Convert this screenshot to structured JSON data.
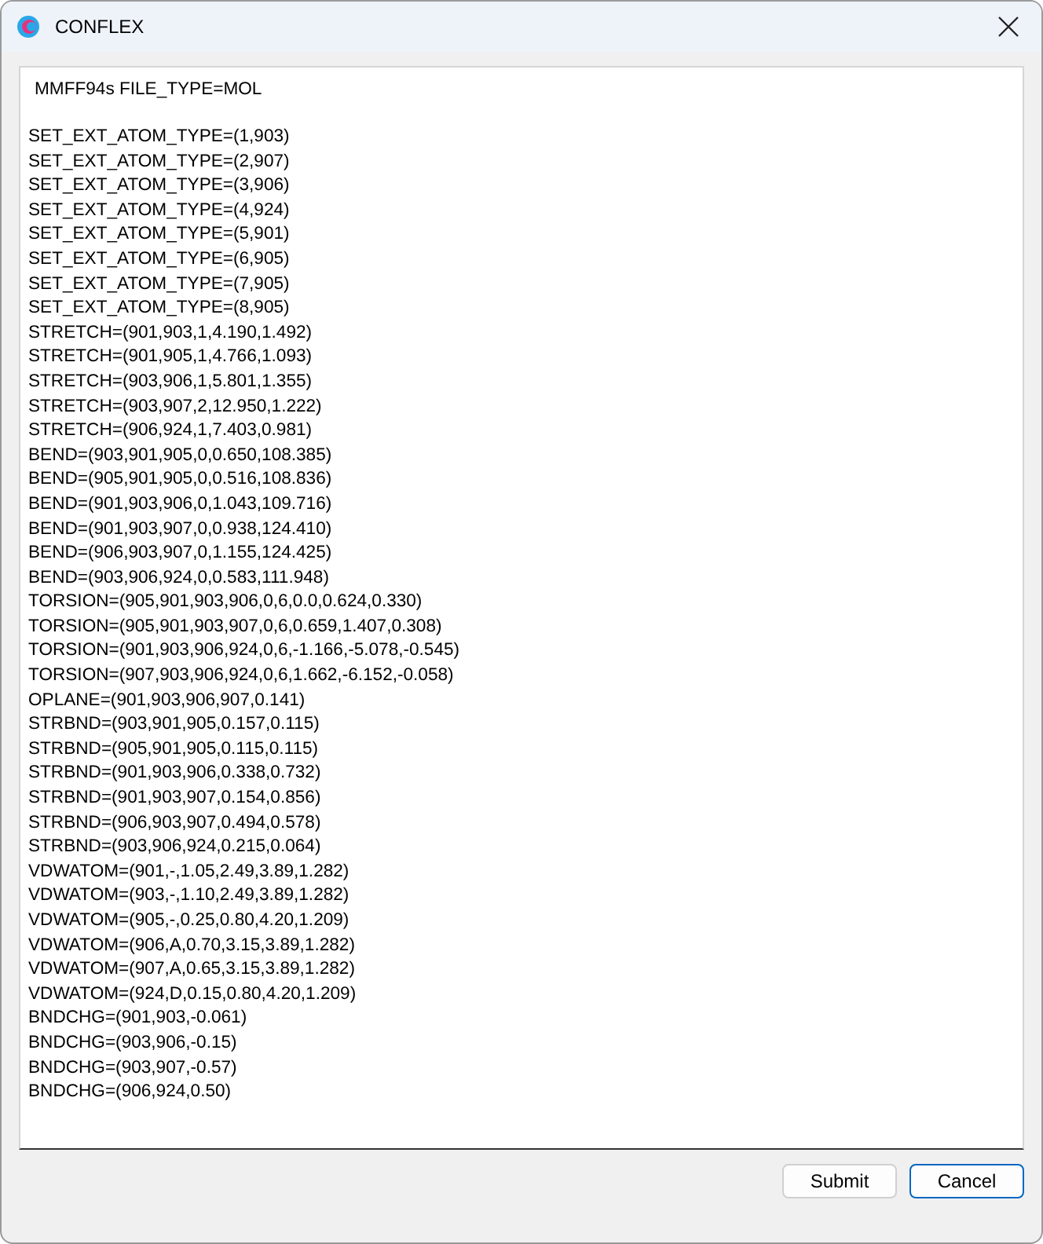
{
  "window": {
    "title": "CONFLEX"
  },
  "editor": {
    "header": "MMFF94s FILE_TYPE=MOL",
    "lines": [
      "SET_EXT_ATOM_TYPE=(1,903)",
      "SET_EXT_ATOM_TYPE=(2,907)",
      "SET_EXT_ATOM_TYPE=(3,906)",
      "SET_EXT_ATOM_TYPE=(4,924)",
      "SET_EXT_ATOM_TYPE=(5,901)",
      "SET_EXT_ATOM_TYPE=(6,905)",
      "SET_EXT_ATOM_TYPE=(7,905)",
      "SET_EXT_ATOM_TYPE=(8,905)",
      "STRETCH=(901,903,1,4.190,1.492)",
      "STRETCH=(901,905,1,4.766,1.093)",
      "STRETCH=(903,906,1,5.801,1.355)",
      "STRETCH=(903,907,2,12.950,1.222)",
      "STRETCH=(906,924,1,7.403,0.981)",
      "BEND=(903,901,905,0,0.650,108.385)",
      "BEND=(905,901,905,0,0.516,108.836)",
      "BEND=(901,903,906,0,1.043,109.716)",
      "BEND=(901,903,907,0,0.938,124.410)",
      "BEND=(906,903,907,0,1.155,124.425)",
      "BEND=(903,906,924,0,0.583,111.948)",
      "TORSION=(905,901,903,906,0,6,0.0,0.624,0.330)",
      "TORSION=(905,901,903,907,0,6,0.659,1.407,0.308)",
      "TORSION=(901,903,906,924,0,6,-1.166,-5.078,-0.545)",
      "TORSION=(907,903,906,924,0,6,1.662,-6.152,-0.058)",
      "OPLANE=(901,903,906,907,0.141)",
      "STRBND=(903,901,905,0.157,0.115)",
      "STRBND=(905,901,905,0.115,0.115)",
      "STRBND=(901,903,906,0.338,0.732)",
      "STRBND=(901,903,907,0.154,0.856)",
      "STRBND=(906,903,907,0.494,0.578)",
      "STRBND=(903,906,924,0.215,0.064)",
      "VDWATOM=(901,-,1.05,2.49,3.89,1.282)",
      "VDWATOM=(903,-,1.10,2.49,3.89,1.282)",
      "VDWATOM=(905,-,0.25,0.80,4.20,1.209)",
      "VDWATOM=(906,A,0.70,3.15,3.89,1.282)",
      "VDWATOM=(907,A,0.65,3.15,3.89,1.282)",
      "VDWATOM=(924,D,0.15,0.80,4.20,1.209)",
      "BNDCHG=(901,903,-0.061)",
      "BNDCHG=(903,906,-0.15)",
      "BNDCHG=(903,907,-0.57)",
      "BNDCHG=(906,924,0.50)"
    ]
  },
  "buttons": [
    {
      "label": "Submit",
      "kind": "normal"
    },
    {
      "label": "Cancel",
      "kind": "default"
    }
  ]
}
